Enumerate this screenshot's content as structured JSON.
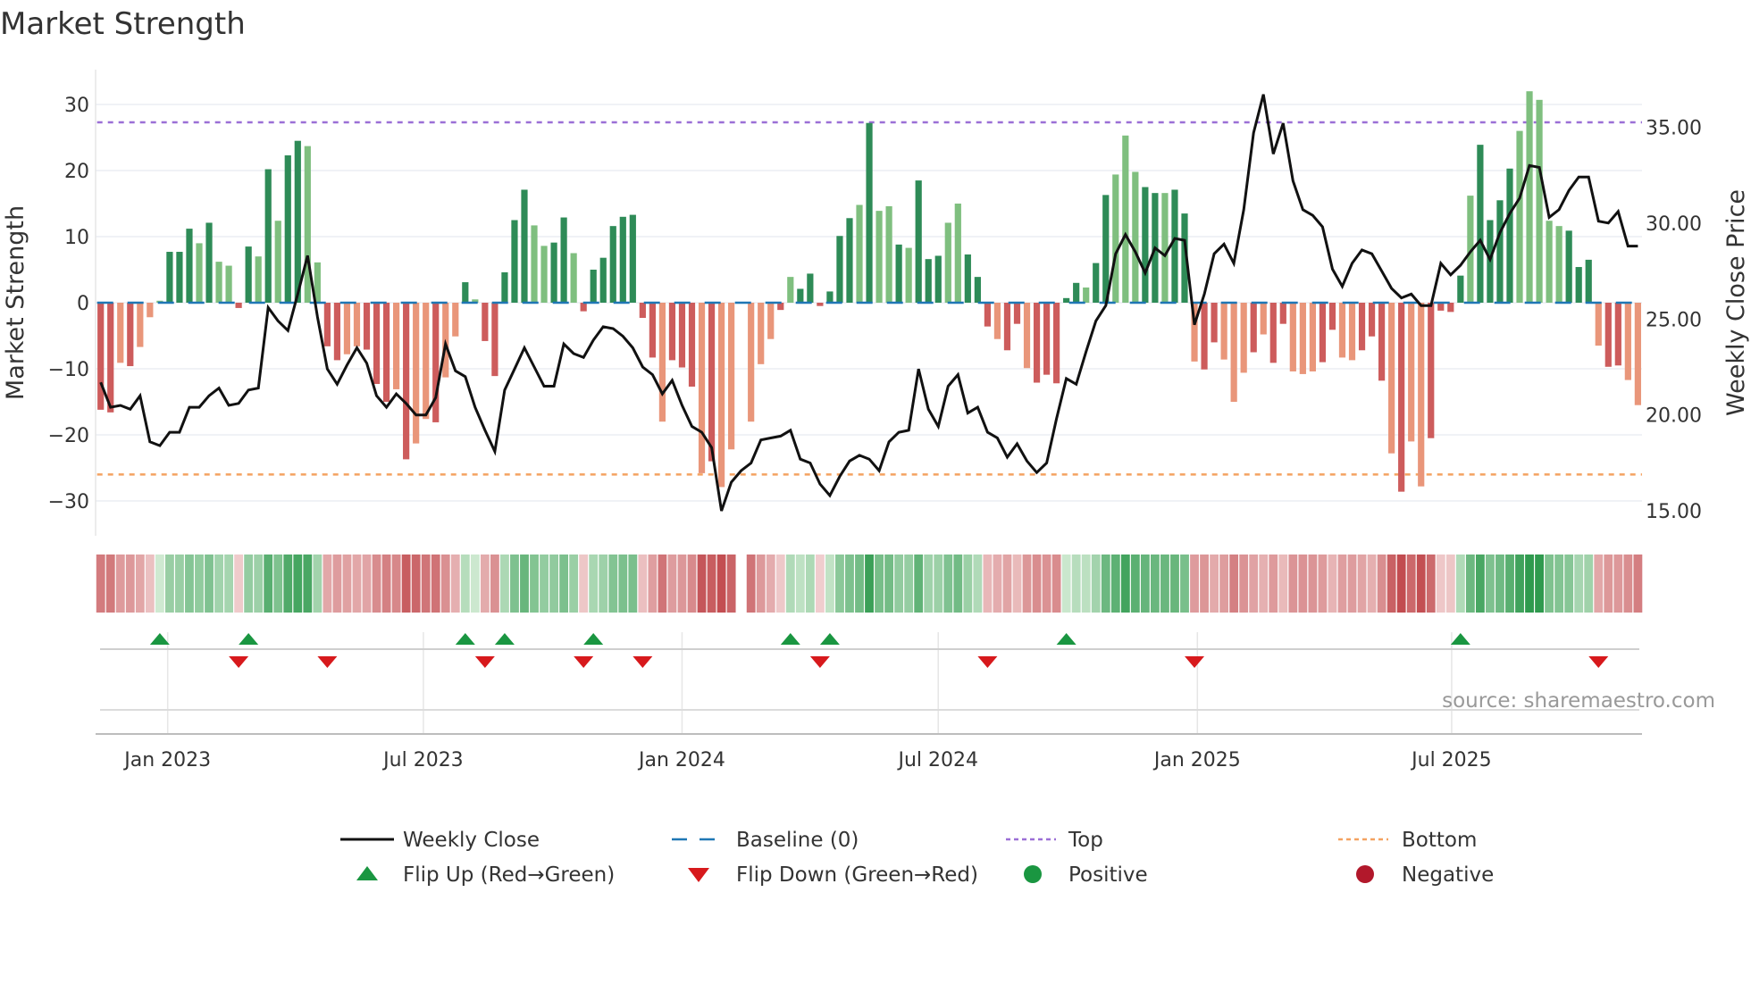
{
  "chart_data": {
    "type": "bar",
    "title": "Market Strength",
    "ylabel": "Market Strength",
    "ylabel_right": "Weekly Close Price",
    "ylim": [
      -35,
      35
    ],
    "ylim_right": [
      13.8,
      37.9
    ],
    "yticks": [
      30,
      20,
      10,
      0,
      -10,
      -20,
      -30
    ],
    "ytick_labels": [
      "30",
      "20",
      "10",
      "0",
      "−10",
      "−20",
      "−30"
    ],
    "yticks_right": [
      35,
      30,
      25,
      20,
      15
    ],
    "ytick_labels_right": [
      "35.00",
      "30.00",
      "25.00",
      "20.00",
      "15.00"
    ],
    "x_ticks": [
      {
        "label": "Jan 2023",
        "week": 6.8
      },
      {
        "label": "Jul 2023",
        "week": 32.75
      },
      {
        "label": "Jan 2024",
        "week": 59.0
      },
      {
        "label": "Jul 2024",
        "week": 85.0
      },
      {
        "label": "Jan 2025",
        "week": 111.3
      },
      {
        "label": "Jul 2025",
        "week": 137.1
      }
    ],
    "top_level": 27.3,
    "bottom_level": -26,
    "baseline": 0,
    "grid": true,
    "legend_placement": "bottom",
    "strength": [
      -16.2,
      -16.6,
      -9.1,
      -9.6,
      -6.7,
      -2.2,
      0.3,
      7.7,
      7.7,
      11.2,
      9.0,
      12.1,
      6.2,
      5.6,
      -0.8,
      8.5,
      7.0,
      20.2,
      12.4,
      22.3,
      24.5,
      23.7,
      6.1,
      -6.6,
      -8.7,
      -7.8,
      -6.6,
      -7.1,
      -12.3,
      -15.0,
      -13.1,
      -23.7,
      -21.3,
      -17.6,
      -18.1,
      -11.3,
      -5.1,
      3.1,
      0.5,
      -5.8,
      -11.1,
      4.6,
      12.5,
      17.1,
      11.7,
      8.6,
      9.1,
      12.9,
      7.5,
      -1.3,
      5.0,
      6.8,
      11.6,
      13.0,
      13.3,
      -2.3,
      -8.3,
      -18.0,
      -8.7,
      -9.8,
      -12.7,
      -25.8,
      -24.0,
      -27.9,
      -22.2,
      null,
      -18.0,
      -9.3,
      -5.5,
      -1.1,
      3.9,
      2.1,
      4.4,
      -0.5,
      1.7,
      10.1,
      12.8,
      14.8,
      27.2,
      13.9,
      14.6,
      8.8,
      8.3,
      18.5,
      6.6,
      7.1,
      12.1,
      15.0,
      7.3,
      3.9,
      -3.6,
      -5.5,
      -7.2,
      -3.2,
      -9.9,
      -12.1,
      -10.9,
      -12.2,
      0.7,
      3.0,
      2.3,
      6.0,
      16.3,
      19.4,
      25.3,
      19.8,
      17.5,
      16.6,
      16.6,
      17.1,
      13.5,
      -8.9,
      -10.1,
      -6.0,
      -8.6,
      -15.0,
      -10.6,
      -7.5,
      -4.8,
      -9.1,
      -3.2,
      -10.4,
      -10.8,
      -10.4,
      -9.0,
      -4.1,
      -8.3,
      -8.7,
      -7.2,
      -5.1,
      -11.8,
      -22.8,
      -28.6,
      -21.0,
      -27.8,
      -20.5,
      -1.2,
      -1.4,
      4.1,
      16.2,
      23.9,
      12.5,
      15.5,
      20.3,
      26.0,
      32.0,
      30.7,
      12.4,
      11.6,
      10.9,
      5.4,
      6.5,
      -6.5,
      -9.7,
      -9.5,
      -11.7,
      -15.5
    ],
    "strength_shade": "DDLDLLLDDDLDLLDDLDLDDLLDDLLDDDLDLLDLLDLDDDDDLLDDLDDDDDDDDLDDDLDLXLLLLDLDDDDDDLDLLDLDDDLLDDDLDDLDDDDDLDDLLLDDLDDLDDLLLDLDDLLLDDLLDDDLDLLDDDDLDDDDLLLLLDDDLDD",
    "weekly_close": [
      21.7,
      20.4,
      20.5,
      20.3,
      21.0,
      18.6,
      18.4,
      19.1,
      19.1,
      20.4,
      20.4,
      21.0,
      21.4,
      20.5,
      20.6,
      21.3,
      21.4,
      25.6,
      24.9,
      24.4,
      26.3,
      28.3,
      25.1,
      22.4,
      21.6,
      22.6,
      23.5,
      22.7,
      21.0,
      20.4,
      21.1,
      20.6,
      20.0,
      20.0,
      20.9,
      23.7,
      22.3,
      22.0,
      20.4,
      19.2,
      18.1,
      21.3,
      22.4,
      23.5,
      22.5,
      21.5,
      21.5,
      23.7,
      23.2,
      23.0,
      23.9,
      24.6,
      24.5,
      24.1,
      23.5,
      22.5,
      22.1,
      21.1,
      21.8,
      20.5,
      19.4,
      19.1,
      18.3,
      15.0,
      16.5,
      17.1,
      17.5,
      18.7,
      18.8,
      18.9,
      19.2,
      17.7,
      17.5,
      16.4,
      15.8,
      16.8,
      17.6,
      17.9,
      17.7,
      17.1,
      18.6,
      19.1,
      19.2,
      22.4,
      20.3,
      19.4,
      21.5,
      22.1,
      20.1,
      20.4,
      19.1,
      18.8,
      17.8,
      18.5,
      17.6,
      17.0,
      17.5,
      19.8,
      21.9,
      21.6,
      23.3,
      24.9,
      25.7,
      28.4,
      29.4,
      28.5,
      27.4,
      28.7,
      28.3,
      29.2,
      29.1,
      24.7,
      26.3,
      28.4,
      28.9,
      27.9,
      30.7,
      34.7,
      36.7,
      33.6,
      35.2,
      32.2,
      30.7,
      30.4,
      29.8,
      27.6,
      26.7,
      27.9,
      28.6,
      28.4,
      27.5,
      26.6,
      26.1,
      26.3,
      25.7,
      25.7,
      27.9,
      27.3,
      27.8,
      28.5,
      29.1,
      28.1,
      29.5,
      30.5,
      31.3,
      33.0,
      32.9,
      30.3,
      30.7,
      31.7,
      32.4,
      32.4,
      30.1,
      30.0,
      30.6,
      28.8,
      28.8
    ],
    "flip_up_weeks": [
      6,
      15,
      37,
      41,
      50,
      70,
      74,
      98,
      138
    ],
    "flip_down_weeks": [
      14,
      23,
      39,
      49,
      55,
      73,
      90,
      111,
      152
    ],
    "legend": [
      {
        "label": "Weekly Close",
        "kind": "line"
      },
      {
        "label": "Baseline (0)",
        "kind": "dash"
      },
      {
        "label": "Top",
        "kind": "dot-purple"
      },
      {
        "label": "Bottom",
        "kind": "dot-orange"
      },
      {
        "label": "Flip Up (Red→Green)",
        "kind": "tri-up"
      },
      {
        "label": "Flip Down (Green→Red)",
        "kind": "tri-down"
      },
      {
        "label": "Positive",
        "kind": "circle-green"
      },
      {
        "label": "Negative",
        "kind": "circle-red"
      }
    ],
    "source": "source: sharemaestro.com"
  },
  "colors": {
    "pos_dark": "#2e8b57",
    "pos_light": "#7fbf7f",
    "neg_dark": "#cd5c5c",
    "neg_light": "#e9967a",
    "baseline": "#1f77b4",
    "top": "#9b6fd6",
    "bottom": "#f4a261",
    "flip_up": "#1a9641",
    "flip_down": "#d7191c",
    "positive": "#1a9641",
    "negative": "#b2182b"
  }
}
